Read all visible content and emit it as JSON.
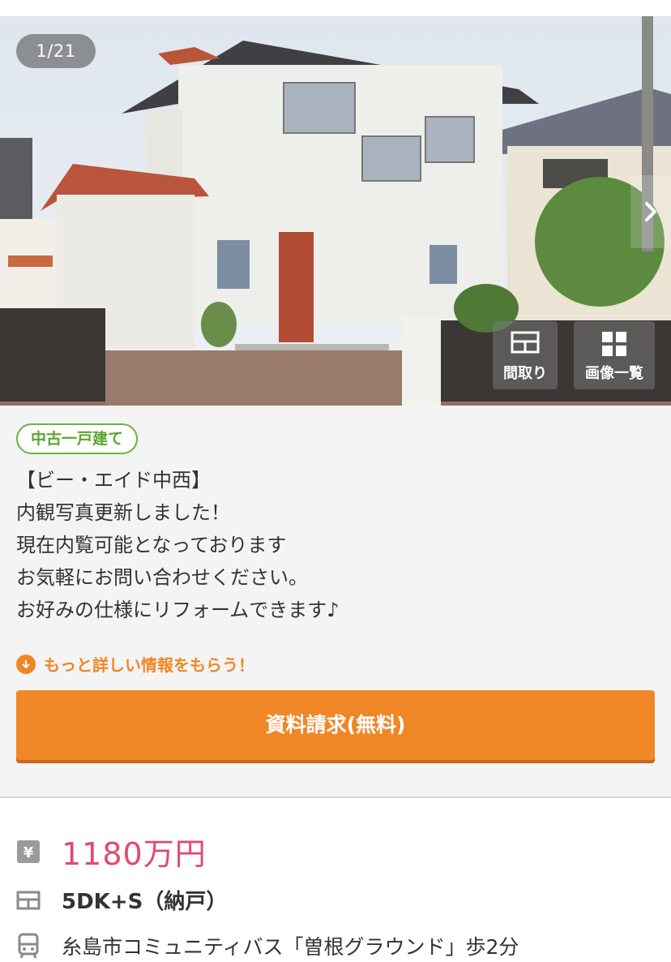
{
  "gallery": {
    "counter": "1/21",
    "floorplan_label": "間取り",
    "gallery_label": "画像一覧"
  },
  "property": {
    "type_badge": "中古一戸建て",
    "description": "【ビー・エイド中西】\n内観写真更新しました！\n現在内覧可能となっております\nお気軽にお問い合わせください。\nお好みの仕様にリフォームできます♪",
    "more_info_label": "もっと詳しい情報をもらう！",
    "cta_label": "資料請求(無料)"
  },
  "details": {
    "price": "1180万円",
    "layout": "5DK+S（納戸）",
    "access": "糸島市コミュニティバス「曽根グラウンド」歩2分"
  },
  "colors": {
    "accent_orange": "#ef8727",
    "price_pink": "#e14a6f",
    "badge_green": "#6cb33f"
  },
  "icons": [
    "yen-icon",
    "floorplan-icon",
    "bus-icon",
    "arrow-down-circle-icon",
    "chevron-right-icon",
    "grid-icon"
  ]
}
